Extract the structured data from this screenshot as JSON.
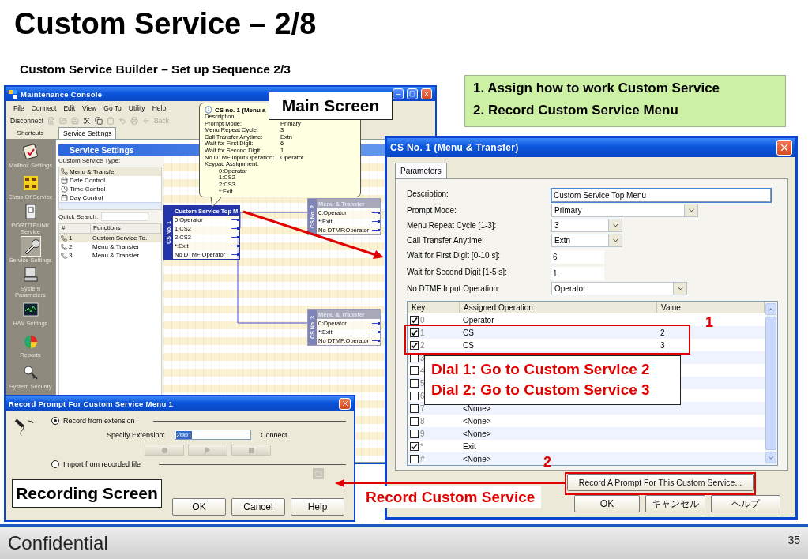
{
  "slide": {
    "title": "Custom Service – 2/8",
    "subtitle": "Custom Service Builder – Set up Sequence 2/3",
    "footer": "Confidential",
    "page_number": "35"
  },
  "steps": [
    "1. Assign how to work Custom Service",
    "2. Record Custom Service Menu"
  ],
  "main_console": {
    "title": "Maintenance Console",
    "menu": [
      "File",
      "Connect",
      "Edit",
      "View",
      "Go To",
      "Utility",
      "Help"
    ],
    "toolbar": [
      {
        "label": "Disconnect",
        "disabled": false
      },
      {
        "label": "Back",
        "disabled": true
      }
    ],
    "shortcuts_label": "Shortcuts",
    "sidebar": [
      {
        "label": "Mailbox Settings",
        "selected": false
      },
      {
        "label": "Class Of Service",
        "selected": false
      },
      {
        "label": "PORT/TRUNK Service",
        "selected": false
      },
      {
        "label": "Service Settings",
        "selected": true
      },
      {
        "label": "System Parameters",
        "selected": false
      },
      {
        "label": "H/W Settings",
        "selected": false
      },
      {
        "label": "Reports",
        "selected": false
      },
      {
        "label": "System Security",
        "selected": false
      }
    ],
    "tab": "Service Settings",
    "panel_title": "Service Settings",
    "type_label": "Custom Service Type:",
    "types": [
      {
        "label": "Menu & Transfer",
        "selected": true
      },
      {
        "label": "Date Control",
        "selected": false
      },
      {
        "label": "Time Control",
        "selected": false
      },
      {
        "label": "Day Control",
        "selected": false
      }
    ],
    "quick_search_label": "Quick Search:",
    "function_columns": [
      "#",
      "Functions"
    ],
    "functions": [
      {
        "number": "1",
        "name": "Custom Service To..",
        "selected": true
      },
      {
        "number": "2",
        "name": "Menu & Transfer",
        "selected": false
      },
      {
        "number": "3",
        "name": "Menu & Transfer",
        "selected": false
      }
    ],
    "tooltip": {
      "title": "CS no. 1 (Menu a",
      "rows": [
        {
          "label": "Description:"
        },
        {
          "label": "Prompt Mode:",
          "value": "Primary"
        },
        {
          "label": "Menu Repeat Cycle:",
          "value": "3"
        },
        {
          "label": "Call Transfer Anytime:",
          "value": "Extn"
        },
        {
          "label": "Wait for First Digit:",
          "value": "6"
        },
        {
          "label": "Wait for Second Digit:",
          "value": "1"
        },
        {
          "label": "No DTMF Input Operation:",
          "value": "Operator"
        },
        {
          "label": "Keypad Assignment:"
        }
      ],
      "keypad": [
        "0:Operator",
        "1:CS2",
        "2:CS3",
        "*:Exit"
      ]
    },
    "nodes": [
      {
        "tag": "CS No. 1",
        "header": "Custom Service Top M",
        "selected": true,
        "rows": [
          "0:Operator",
          "1:CS2",
          "2:CS3",
          "*:Exit",
          "No DTMF:Operator"
        ]
      },
      {
        "tag": "CS No. 2",
        "header": "Menu & Transfer",
        "selected": false,
        "rows": [
          "0:Operator",
          "*:Exit",
          "No DTMF:Operator"
        ]
      },
      {
        "tag": "CS No. 3",
        "header": "Menu & Transfer",
        "selected": false,
        "rows": [
          "0:Operator",
          "*:Exit",
          "No DTMF:Operator"
        ]
      }
    ]
  },
  "cs_dialog": {
    "title": "CS No. 1 (Menu & Transfer)",
    "tab": "Parameters",
    "fields": [
      {
        "label": "Description:",
        "kind": "text",
        "value": "Custom Service Top Menu"
      },
      {
        "label": "Prompt Mode:",
        "kind": "select",
        "value": "Primary"
      },
      {
        "label": "Menu Repeat Cycle [1-3]:",
        "kind": "select",
        "value": "3"
      },
      {
        "label": "Call Transfer Anytime:",
        "kind": "select",
        "value": "Extn"
      },
      {
        "label": "Wait for First Digit [0-10 s]:",
        "kind": "number",
        "value": "6"
      },
      {
        "label": "Wait for Second Digit [1-5 s]:",
        "kind": "number",
        "value": "1"
      },
      {
        "label": "No DTMF Input Operation:",
        "kind": "select",
        "value": "Operator"
      }
    ],
    "columns": [
      "Key",
      "Assigned Operation",
      "Value"
    ],
    "rows": [
      {
        "key": "0",
        "checked": true,
        "operation": "Operator"
      },
      {
        "key": "1",
        "checked": true,
        "operation": "CS",
        "value": "2"
      },
      {
        "key": "2",
        "checked": true,
        "operation": "CS",
        "value": "3"
      },
      {
        "key": "3",
        "checked": false
      },
      {
        "key": "4",
        "checked": false
      },
      {
        "key": "5",
        "checked": false
      },
      {
        "key": "6",
        "checked": false
      },
      {
        "key": "7",
        "checked": false,
        "operation": "<None>"
      },
      {
        "key": "8",
        "checked": false,
        "operation": "<None>"
      },
      {
        "key": "9",
        "checked": false,
        "operation": "<None>"
      },
      {
        "key": "*",
        "checked": true,
        "operation": "Exit"
      },
      {
        "key": "#",
        "checked": false,
        "operation": "<None>"
      }
    ],
    "record_button": "Record A Prompt For This Custom Service...",
    "buttons": [
      "OK",
      "キャンセル",
      "ヘルプ"
    ]
  },
  "record_dialog": {
    "title": "Record Prompt For Custom Service Menu 1",
    "options": [
      {
        "label": "Record from extension",
        "selected": true
      },
      {
        "label": "Import from recorded file",
        "selected": false
      }
    ],
    "extension_label": "Specify Extension:",
    "extension": "2001",
    "connect": "Connect",
    "buttons": [
      "OK",
      "Cancel",
      "Help"
    ]
  },
  "annotations": {
    "main_screen": "Main Screen",
    "recording_screen": "Recording Screen",
    "dial_notes": [
      "Dial 1: Go to Custom Service 2",
      "Dial 2: Go to Custom Service 3"
    ],
    "record_note": "Record Custom Service",
    "marker_1": "1",
    "marker_2": "2"
  }
}
